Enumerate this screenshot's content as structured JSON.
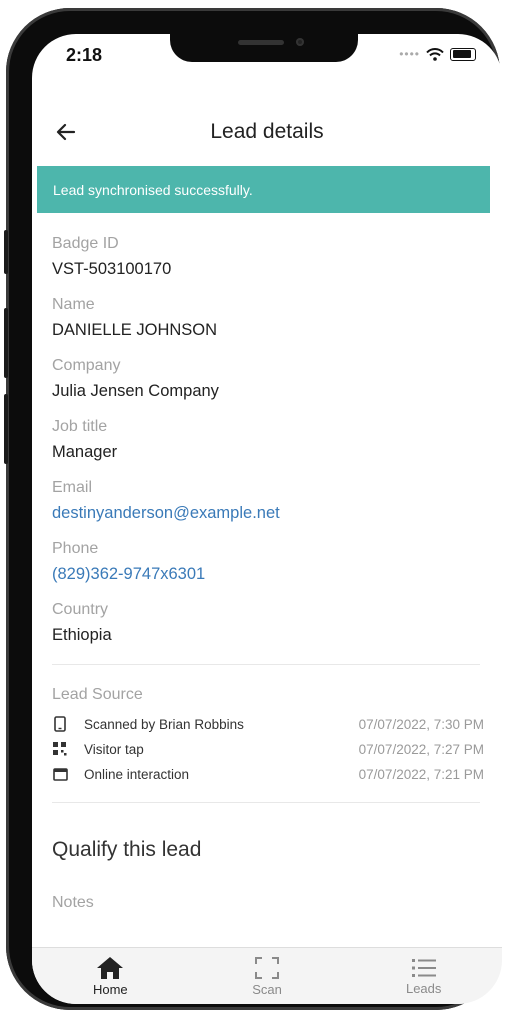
{
  "status_bar": {
    "time": "2:18"
  },
  "header": {
    "title": "Lead details"
  },
  "banner": {
    "message": "Lead synchronised successfully."
  },
  "fields": [
    {
      "label": "Badge ID",
      "value": "VST-503100170"
    },
    {
      "label": "Name",
      "value": "DANIELLE JOHNSON"
    },
    {
      "label": "Company",
      "value": "Julia Jensen Company"
    },
    {
      "label": "Job title",
      "value": "Manager"
    },
    {
      "label": "Email",
      "value": "destinyanderson@example.net"
    },
    {
      "label": "Phone",
      "value": "(829)362-9747x6301"
    },
    {
      "label": "Country",
      "value": "Ethiopia"
    }
  ],
  "lead_source": {
    "label": "Lead Source",
    "items": [
      {
        "icon": "phone-icon",
        "text": "Scanned by Brian Robbins",
        "time": "07/07/2022, 7:30 PM"
      },
      {
        "icon": "qr-code-icon",
        "text": "Visitor tap",
        "time": "07/07/2022, 7:27 PM"
      },
      {
        "icon": "browser-window-icon",
        "text": "Online interaction",
        "time": "07/07/2022, 7:21 PM"
      }
    ]
  },
  "qualify": {
    "title": "Qualify this lead",
    "notes_label": "Notes"
  },
  "bottom_nav": {
    "items": [
      {
        "icon": "home-icon",
        "label": "Home",
        "active": true
      },
      {
        "icon": "scan-icon",
        "label": "Scan",
        "active": false
      },
      {
        "icon": "list-icon",
        "label": "Leads",
        "active": false
      }
    ]
  },
  "colors": {
    "accent": "#4db6ac",
    "link": "#3a7ab8",
    "label": "#a3a3a3"
  }
}
